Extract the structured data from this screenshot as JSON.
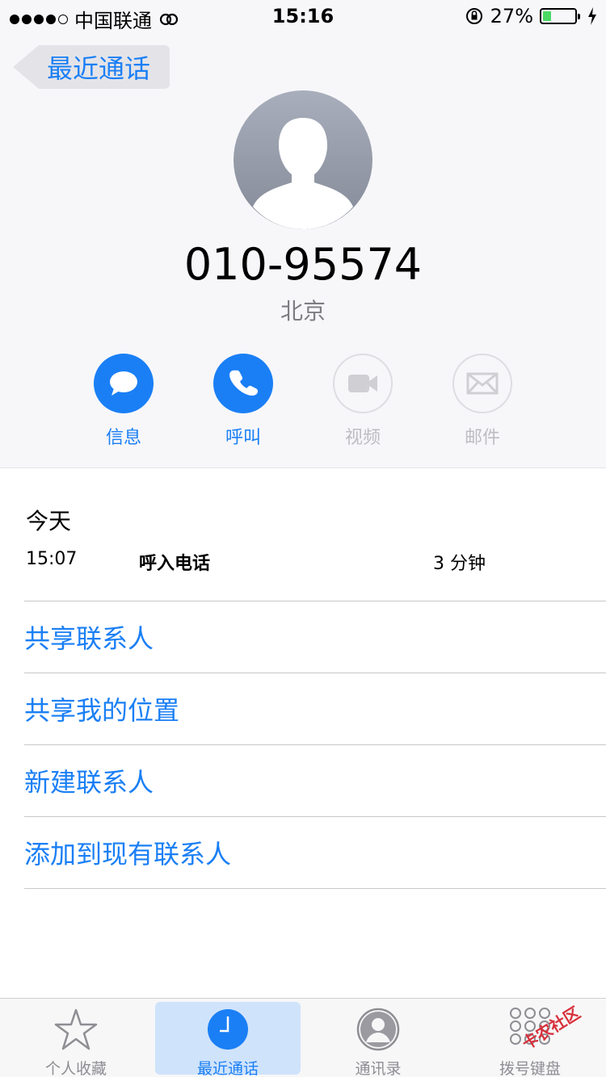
{
  "status_bar": {
    "carrier": "中国联通",
    "time": "15:16",
    "battery_percent": "27%",
    "battery_level": 0.27,
    "signal_bars_filled": 4,
    "signal_bars_total": 5
  },
  "nav": {
    "back_label": "最近通话"
  },
  "contact": {
    "number": "010-95574",
    "location": "北京"
  },
  "actions": [
    {
      "label": "信息",
      "icon": "message-icon",
      "enabled": true
    },
    {
      "label": "呼叫",
      "icon": "phone-icon",
      "enabled": true
    },
    {
      "label": "视频",
      "icon": "video-icon",
      "enabled": false
    },
    {
      "label": "邮件",
      "icon": "mail-icon",
      "enabled": false
    }
  ],
  "recents": {
    "day": "今天",
    "calls": [
      {
        "time": "15:07",
        "type": "呼入电话",
        "duration": "3 分钟"
      }
    ]
  },
  "options": [
    "共享联系人",
    "共享我的位置",
    "新建联系人",
    "添加到现有联系人"
  ],
  "tabs": [
    {
      "label": "个人收藏",
      "icon": "star-icon",
      "active": false
    },
    {
      "label": "最近通话",
      "icon": "clock-icon",
      "active": true
    },
    {
      "label": "通讯录",
      "icon": "contacts-icon",
      "active": false
    },
    {
      "label": "拨号键盘",
      "icon": "keypad-icon",
      "active": false
    }
  ],
  "watermark": "卡农社区",
  "colors": {
    "accent": "#1a7ff5",
    "battery": "#4cd964"
  }
}
